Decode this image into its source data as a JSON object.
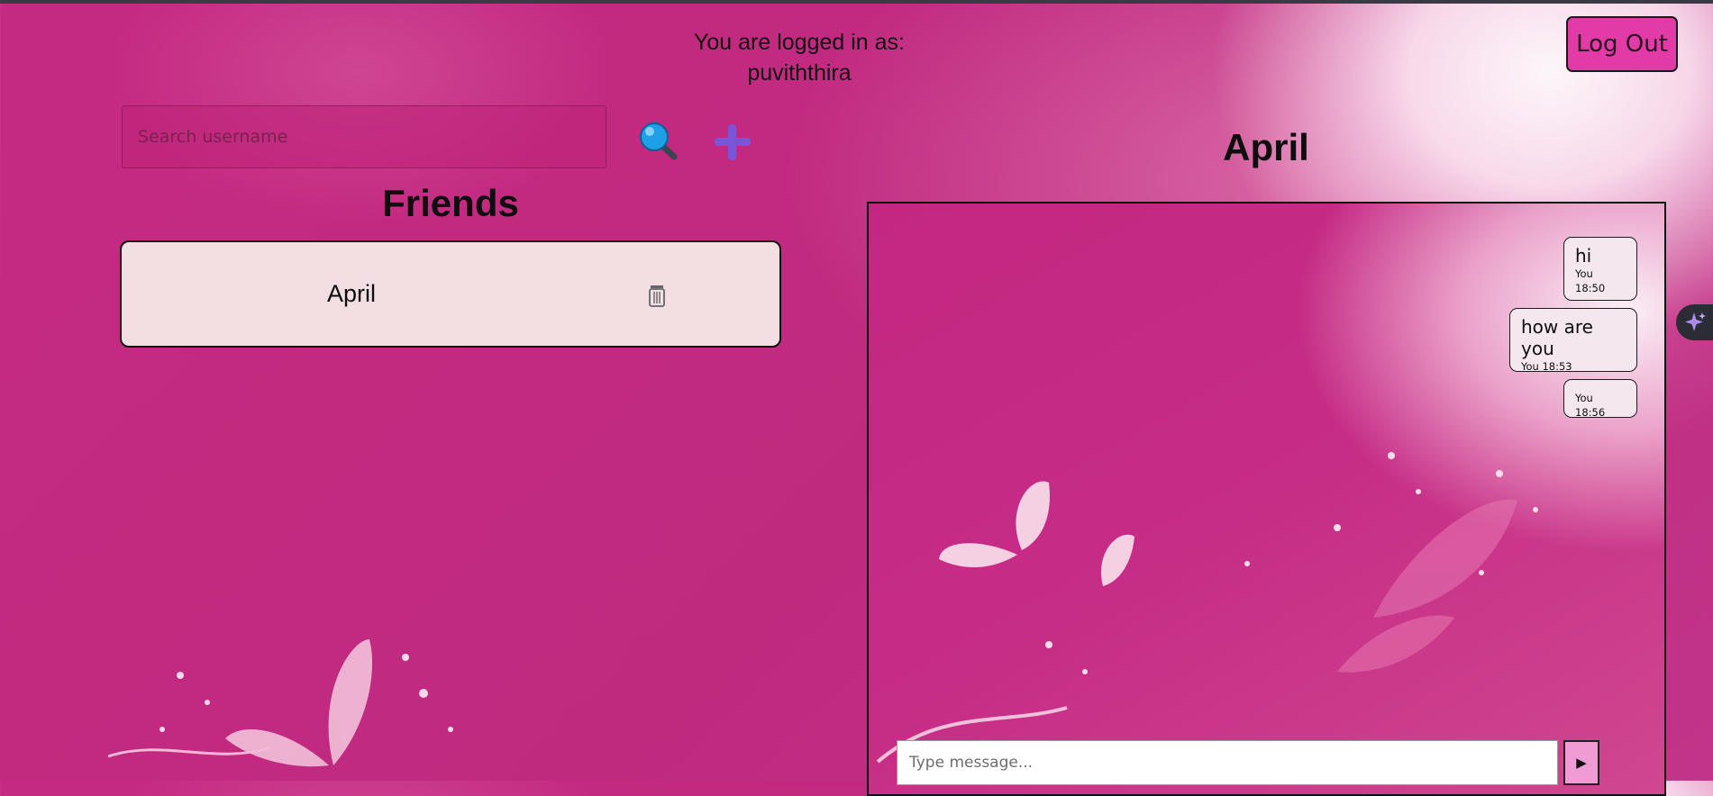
{
  "header": {
    "logged_in_label": "You are logged in as:",
    "username": "puviththira",
    "logout_label": "Log Out"
  },
  "search": {
    "placeholder": "Search username",
    "value": "",
    "search_icon": "magnifier-icon",
    "add_icon": "plus-icon"
  },
  "friends": {
    "title": "Friends",
    "items": [
      {
        "name": "April",
        "action_icon": "trash-icon"
      }
    ]
  },
  "chat": {
    "title": "April",
    "messages": [
      {
        "text": "hi",
        "meta": "You 18:50"
      },
      {
        "text": "how are you",
        "meta": "You 18:53"
      },
      {
        "text": "",
        "meta": "You 18:56"
      }
    ],
    "input_placeholder": "Type message...",
    "send_label": "▶"
  },
  "colors": {
    "background": "#c52a82",
    "logout_button": "#e23aa6",
    "friend_card": "#f3dfe1",
    "message_bubble": "#f4e8ee",
    "send_button": "#f09bd4",
    "search_icon": "#1ea0e6",
    "add_icon": "#7a55d8"
  }
}
